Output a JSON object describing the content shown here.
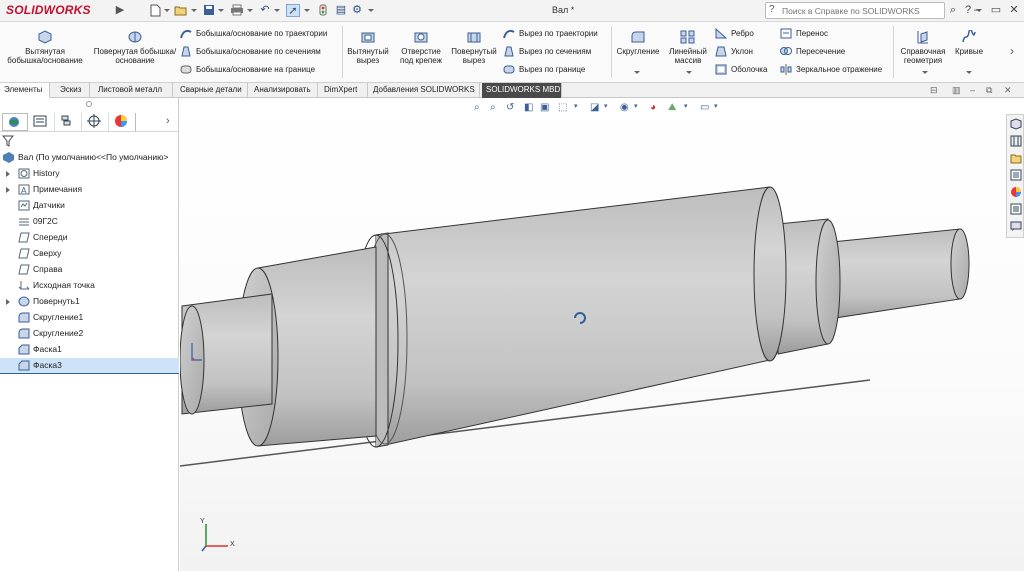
{
  "app": {
    "logo": "SOLIDWORKS",
    "doc_title": "Вал *"
  },
  "search": {
    "placeholder": "Поиск в Справке по SOLIDWORKS"
  },
  "toolbar": {
    "extrude_boss": "Вытянутая бобышка/основание",
    "revolve_boss": "Повернутая бобышка/основание",
    "swept_boss": "Бобышка/основание по траектории",
    "lofted_boss": "Бобышка/основание по сечениям",
    "boundary_boss": "Бобышка/основание на границе",
    "extrude_cut": "Вытянутый вырез",
    "hole_wizard": "Отверстие под крепеж",
    "revolve_cut": "Повернутый вырез",
    "swept_cut": "Вырез по траектории",
    "lofted_cut": "Вырез по сечениям",
    "boundary_cut": "Вырез по границе",
    "fillet": "Скругление",
    "linear_pattern": "Линейный массив",
    "rib": "Ребро",
    "draft": "Уклон",
    "shell": "Оболочка",
    "wrap": "Перенос",
    "intersect": "Пересечение",
    "mirror": "Зеркальное отражение",
    "ref_geometry": "Справочная геометрия",
    "curves": "Кривые"
  },
  "tabs": [
    "Элементы",
    "Эскиз",
    "Листовой металл",
    "Сварные детали",
    "Анализировать",
    "DimXpert",
    "Добавления SOLIDWORKS",
    "SOLIDWORKS MBD"
  ],
  "tree": {
    "root": "Вал  (По умолчанию<<По умолчанию>",
    "items": [
      "History",
      "Примечания",
      "Датчики",
      "09Г2С",
      "Спереди",
      "Сверху",
      "Справа",
      "Исходная точка",
      "Повернуть1",
      "Скругление1",
      "Скругление2",
      "Фаска1",
      "Фаска3"
    ]
  },
  "triad": {
    "x": "X",
    "y": "Y"
  },
  "colors": {
    "accent": "#2e5f9e",
    "brand": "#c4122f",
    "selection": "#cde3f7",
    "part": "#c8c8c8"
  }
}
